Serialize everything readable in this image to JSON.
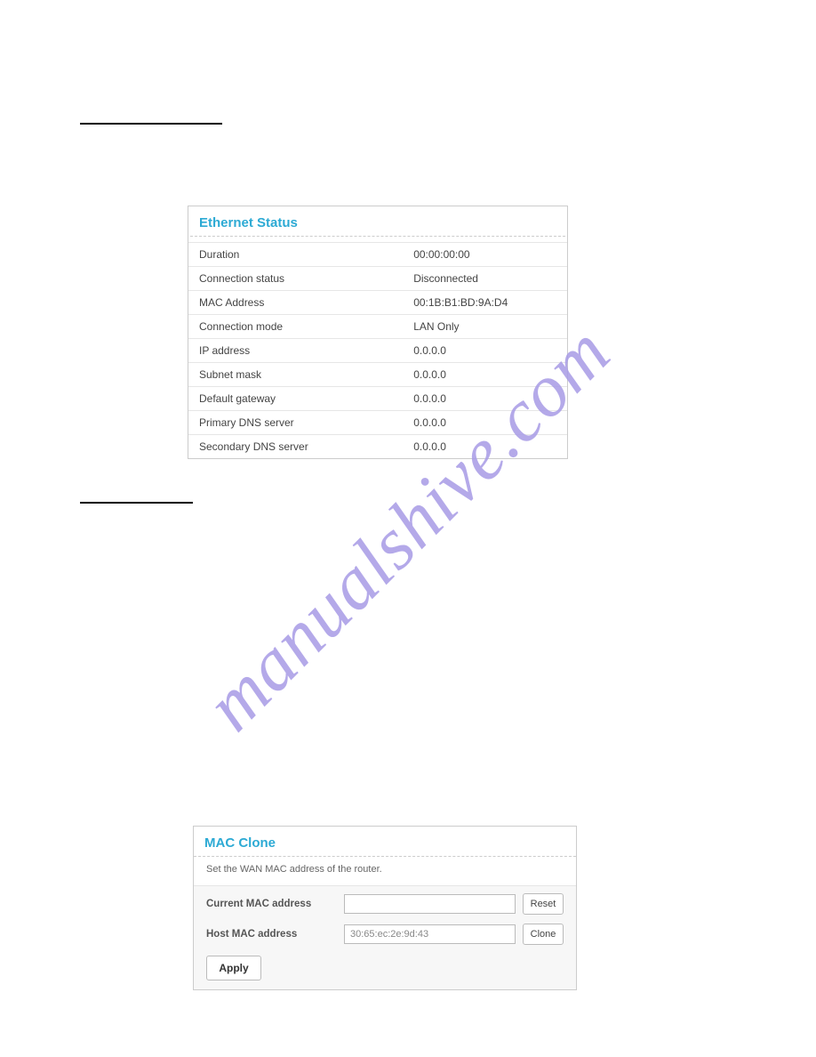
{
  "watermark": "manualshive.com",
  "headings": {
    "ethernet_status": "Ethernet Status",
    "mac_clone": "MAC Clone"
  },
  "ethernet_status": {
    "title": "Ethernet Status",
    "rows": [
      {
        "label": "Duration",
        "value": "00:00:00:00"
      },
      {
        "label": "Connection status",
        "value": "Disconnected"
      },
      {
        "label": "MAC Address",
        "value": "00:1B:B1:BD:9A:D4"
      },
      {
        "label": "Connection mode",
        "value": "LAN Only"
      },
      {
        "label": "IP address",
        "value": "0.0.0.0"
      },
      {
        "label": "Subnet mask",
        "value": "0.0.0.0"
      },
      {
        "label": "Default gateway",
        "value": "0.0.0.0"
      },
      {
        "label": "Primary DNS server",
        "value": "0.0.0.0"
      },
      {
        "label": "Secondary DNS server",
        "value": "0.0.0.0"
      }
    ]
  },
  "mac_clone": {
    "title": "MAC Clone",
    "description": "Set the WAN MAC address of the router.",
    "current_label": "Current MAC address",
    "current_value": "",
    "reset_label": "Reset",
    "host_label": "Host MAC address",
    "host_value": "30:65:ec:2e:9d:43",
    "clone_label": "Clone",
    "apply_label": "Apply"
  }
}
